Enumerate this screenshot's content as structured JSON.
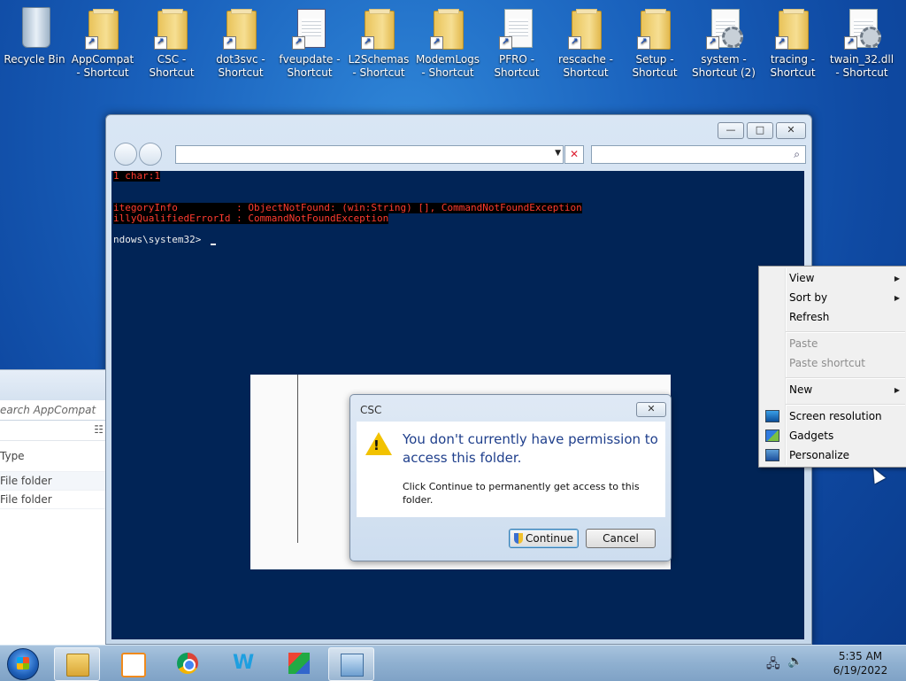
{
  "desktop": {
    "icons": [
      {
        "label": "Recycle Bin",
        "icon": "recycle-bin-icon"
      },
      {
        "label": "AppCompat - Shortcut",
        "icon": "folder-shortcut-icon"
      },
      {
        "label": "CSC - Shortcut",
        "icon": "folder-shortcut-icon"
      },
      {
        "label": "dot3svc - Shortcut",
        "icon": "folder-shortcut-icon"
      },
      {
        "label": "fveupdate - Shortcut",
        "icon": "app-window-shortcut-icon"
      },
      {
        "label": "L2Schemas - Shortcut",
        "icon": "folder-shortcut-icon"
      },
      {
        "label": "ModemLogs - Shortcut",
        "icon": "folder-shortcut-icon"
      },
      {
        "label": "PFRO - Shortcut",
        "icon": "text-file-shortcut-icon"
      },
      {
        "label": "rescache - Shortcut",
        "icon": "folder-shortcut-icon"
      },
      {
        "label": "Setup - Shortcut",
        "icon": "folder-shortcut-icon"
      },
      {
        "label": "system - Shortcut (2)",
        "icon": "system-file-shortcut-icon"
      },
      {
        "label": "tracing - Shortcut",
        "icon": "folder-shortcut-icon"
      },
      {
        "label": "twain_32.dll - Shortcut",
        "icon": "dll-shortcut-icon"
      }
    ]
  },
  "console": {
    "lines": {
      "l1": "1 char:1",
      "l2": "itegoryInfo          : ObjectNotFound: (win:String) [], CommandNotFoundException",
      "l3": "illyQualifiedErrorId : CommandNotFoundException",
      "l4": "ndows\\system32> "
    },
    "window_buttons": {
      "minimize": "—",
      "maximize": "□",
      "close": "✕"
    }
  },
  "explorer": {
    "search_placeholder": "earch AppCompat",
    "column_type": "Type",
    "rows": [
      "File folder",
      "File folder"
    ]
  },
  "dialog": {
    "title": "CSC",
    "close": "✕",
    "heading": "You don't currently have permission to access this folder.",
    "message": "Click Continue to permanently get access to this folder.",
    "continue_label": "Continue",
    "cancel_label": "Cancel"
  },
  "context_menu": {
    "view": "View",
    "sort_by": "Sort by",
    "refresh": "Refresh",
    "paste": "Paste",
    "paste_shortcut": "Paste shortcut",
    "new": "New",
    "screen_resolution": "Screen resolution",
    "gadgets": "Gadgets",
    "personalize": "Personalize"
  },
  "taskbar": {
    "time": "5:35 AM",
    "date": "6/19/2022",
    "items": [
      "explorer",
      "media-player",
      "chrome",
      "wps-writer",
      "app-3d-blocks",
      "remote-desktop"
    ]
  }
}
